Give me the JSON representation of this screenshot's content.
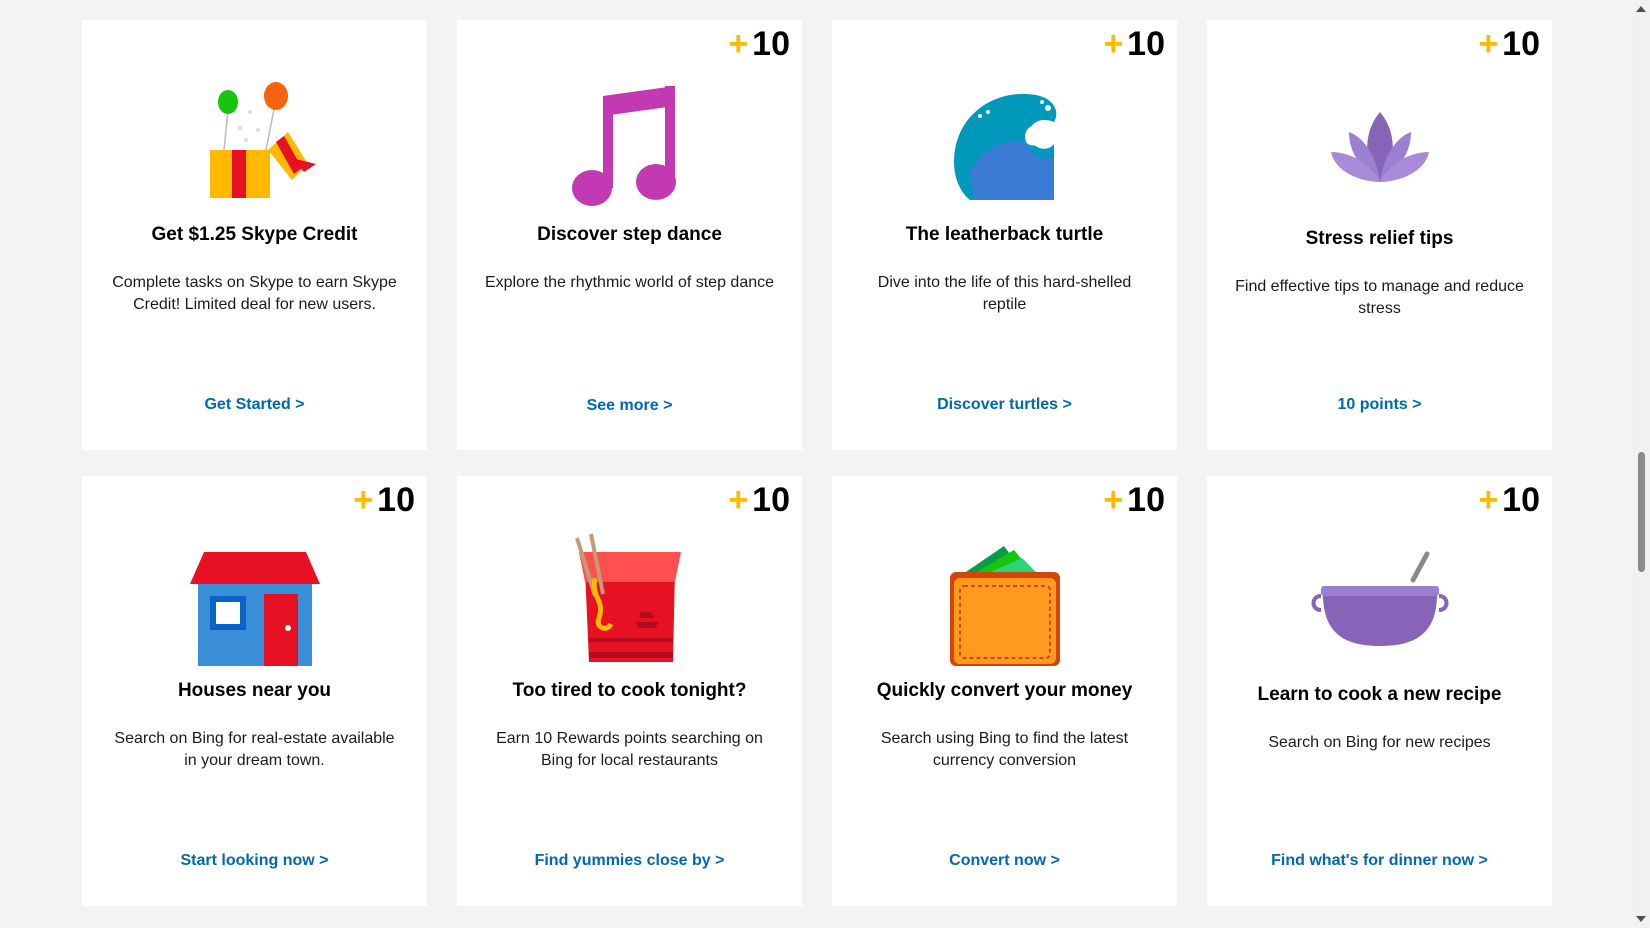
{
  "cards": [
    {
      "title": "Get $1.25 Skype Credit",
      "description": "Complete tasks on Skype to earn Skype Credit! Limited deal for new users.",
      "link": "Get Started >",
      "icon": "gift-balloons-icon"
    },
    {
      "points": "10",
      "plus": "+",
      "title": "Discover step dance",
      "description": "Explore the rhythmic world of step dance",
      "link": "See more >",
      "icon": "music-note-icon"
    },
    {
      "points": "10",
      "plus": "+",
      "title": "The leatherback turtle",
      "description": "Dive into the life of this hard-shelled reptile",
      "link": "Discover turtles >",
      "icon": "ocean-wave-icon"
    },
    {
      "points": "10",
      "plus": "+",
      "title": "Stress relief tips",
      "description": "Find effective tips to manage and reduce stress",
      "link": "10 points >",
      "icon": "lotus-icon"
    },
    {
      "points": "10",
      "plus": "+",
      "title": "Houses near you",
      "description": "Search on Bing for real-estate available in your dream town.",
      "link": "Start looking now >",
      "icon": "house-icon"
    },
    {
      "points": "10",
      "plus": "+",
      "title": "Too tired to cook tonight?",
      "description": "Earn 10 Rewards points searching on Bing for local restaurants",
      "link": "Find yummies close by >",
      "icon": "takeout-box-icon"
    },
    {
      "points": "10",
      "plus": "+",
      "title": "Quickly convert your money",
      "description": "Search using Bing to find the latest currency conversion",
      "link": "Convert now >",
      "icon": "wallet-icon"
    },
    {
      "points": "10",
      "plus": "+",
      "title": "Learn to cook a new recipe",
      "description": "Search on Bing for new recipes",
      "link": "Find what's for dinner now >",
      "icon": "cooking-pot-icon"
    }
  ],
  "colors": {
    "link": "#0067b8",
    "plus": "#ffb900",
    "background": "#f3f3f3",
    "card": "#ffffff"
  }
}
